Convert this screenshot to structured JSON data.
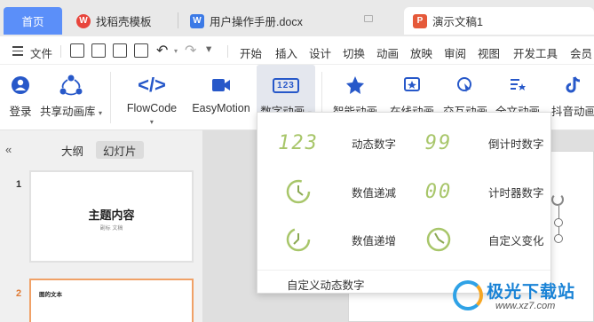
{
  "tabs": {
    "home": "首页",
    "template": "找稻壳模板",
    "doc": "用户操作手册.docx",
    "presentation": "演示文稿1"
  },
  "menubar": {
    "file": "文件",
    "items": [
      "开始",
      "插入",
      "设计",
      "切换",
      "动画",
      "放映",
      "审阅",
      "视图",
      "开发工具",
      "会员"
    ]
  },
  "ribbon": {
    "login": "登录",
    "share_anim": "共享动画库",
    "flowcode": "FlowCode",
    "easymotion": "EasyMotion",
    "num_anim": "数字动画",
    "smart_anim": "智能动画",
    "online_anim": "在线动画",
    "interactive_anim": "交互动画",
    "fulltext_anim": "全文动画",
    "douyin_anim": "抖音动画",
    "num_anim_icon_text": "123"
  },
  "left_panel": {
    "outline_tab": "大纲",
    "slides_tab": "幻灯片",
    "slide1_num": "1",
    "slide1_title": "主题内容",
    "slide1_sub": "副标 文稿",
    "slide2_num": "2",
    "slide2_title": "图的文本"
  },
  "dropdown": {
    "items": [
      {
        "label": "动态数字",
        "icon": "digits",
        "icon_text": "123"
      },
      {
        "label": "倒计时数字",
        "icon": "digits",
        "icon_text": "99"
      },
      {
        "label": "数值递减",
        "icon": "clock-decrease-icon"
      },
      {
        "label": "计时器数字",
        "icon": "digits",
        "icon_text": "00"
      },
      {
        "label": "数值递增",
        "icon": "clock-increase-icon"
      },
      {
        "label": "自定义变化",
        "icon": "clock-custom-icon"
      }
    ],
    "custom": "自定义动态数字"
  },
  "watermark": {
    "brand": "极光下载站",
    "url": "www.xz7.com"
  },
  "colors": {
    "home_tab": "#5b8ff9",
    "ribbon_icon": "#2758c9",
    "digit_green": "#a8c66a",
    "active_slide_border": "#f0a167"
  }
}
